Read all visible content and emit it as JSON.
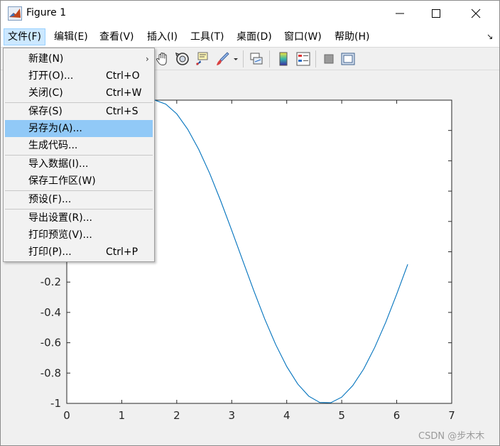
{
  "window": {
    "title": "Figure 1"
  },
  "menubar": {
    "items": [
      {
        "label": "文件(F)"
      },
      {
        "label": "编辑(E)"
      },
      {
        "label": "查看(V)"
      },
      {
        "label": "插入(I)"
      },
      {
        "label": "工具(T)"
      },
      {
        "label": "桌面(D)"
      },
      {
        "label": "窗口(W)"
      },
      {
        "label": "帮助(H)"
      }
    ],
    "active": "文件(F)"
  },
  "file_menu": {
    "items": [
      {
        "label": "新建(N)",
        "shortcut": "",
        "submenu": true
      },
      {
        "label": "打开(O)...",
        "shortcut": "Ctrl+O"
      },
      {
        "label": "关闭(C)",
        "shortcut": "Ctrl+W"
      },
      {
        "label": "保存(S)",
        "shortcut": "Ctrl+S"
      },
      {
        "label": "另存为(A)...",
        "shortcut": "",
        "highlighted": true
      },
      {
        "label": "生成代码...",
        "shortcut": ""
      },
      {
        "label": "导入数据(I)...",
        "shortcut": ""
      },
      {
        "label": "保存工作区(W)",
        "shortcut": ""
      },
      {
        "label": "预设(F)...",
        "shortcut": ""
      },
      {
        "label": "导出设置(R)...",
        "shortcut": ""
      },
      {
        "label": "打印预览(V)...",
        "shortcut": ""
      },
      {
        "label": "打印(P)...",
        "shortcut": "Ctrl+P"
      }
    ],
    "submenu_arrow": "›"
  },
  "toolbar": {
    "icons": [
      "pan-hand-icon",
      "rotate-3d-icon",
      "data-cursor-icon",
      "brush-icon",
      "brush-dropdown-icon",
      "link-plot-icon",
      "colorbar-icon",
      "legend-icon",
      "hide-plot-tools-icon",
      "show-plot-tools-icon"
    ]
  },
  "colors": {
    "line": "#0072bd",
    "menu_highlight": "#91c9f7",
    "menubar_active": "#cce8ff",
    "axes_bg": "#ffffff",
    "figure_bg": "#f0f0f0"
  },
  "chart_data": {
    "type": "line",
    "title": "",
    "xlabel": "",
    "ylabel": "",
    "xlim": [
      0,
      7
    ],
    "ylim": [
      -1,
      1
    ],
    "xticks": [
      0,
      1,
      2,
      3,
      4,
      5,
      6,
      7
    ],
    "xtick_labels": [
      "0",
      "1",
      "2",
      "3",
      "4",
      "5",
      "6",
      "7"
    ],
    "yticks_visible": [
      -1,
      -0.8,
      -0.6,
      -0.4,
      -0.2
    ],
    "ytick_labels": [
      "-1",
      "-0.8",
      "-0.6",
      "-0.4",
      "-0.2"
    ],
    "grid": false,
    "series": [
      {
        "color": "#0072bd",
        "x": [
          0.0,
          0.2,
          0.4,
          0.6,
          0.8,
          1.0,
          1.2,
          1.4,
          1.6,
          1.8,
          2.0,
          2.2,
          2.4,
          2.6,
          2.8,
          3.0,
          3.2,
          3.4,
          3.6,
          3.8,
          4.0,
          4.2,
          4.4,
          4.6,
          4.8,
          5.0,
          5.2,
          5.4,
          5.6,
          5.8,
          6.0,
          6.2
        ],
        "y": [
          0.0,
          0.199,
          0.389,
          0.565,
          0.717,
          0.841,
          0.932,
          0.985,
          1.0,
          0.974,
          0.909,
          0.808,
          0.675,
          0.516,
          0.335,
          0.141,
          -0.058,
          -0.256,
          -0.443,
          -0.612,
          -0.757,
          -0.872,
          -0.952,
          -0.994,
          -0.996,
          -0.959,
          -0.883,
          -0.773,
          -0.631,
          -0.465,
          -0.279,
          -0.083
        ]
      }
    ]
  },
  "watermark": {
    "text": "CSDN @步木木"
  }
}
